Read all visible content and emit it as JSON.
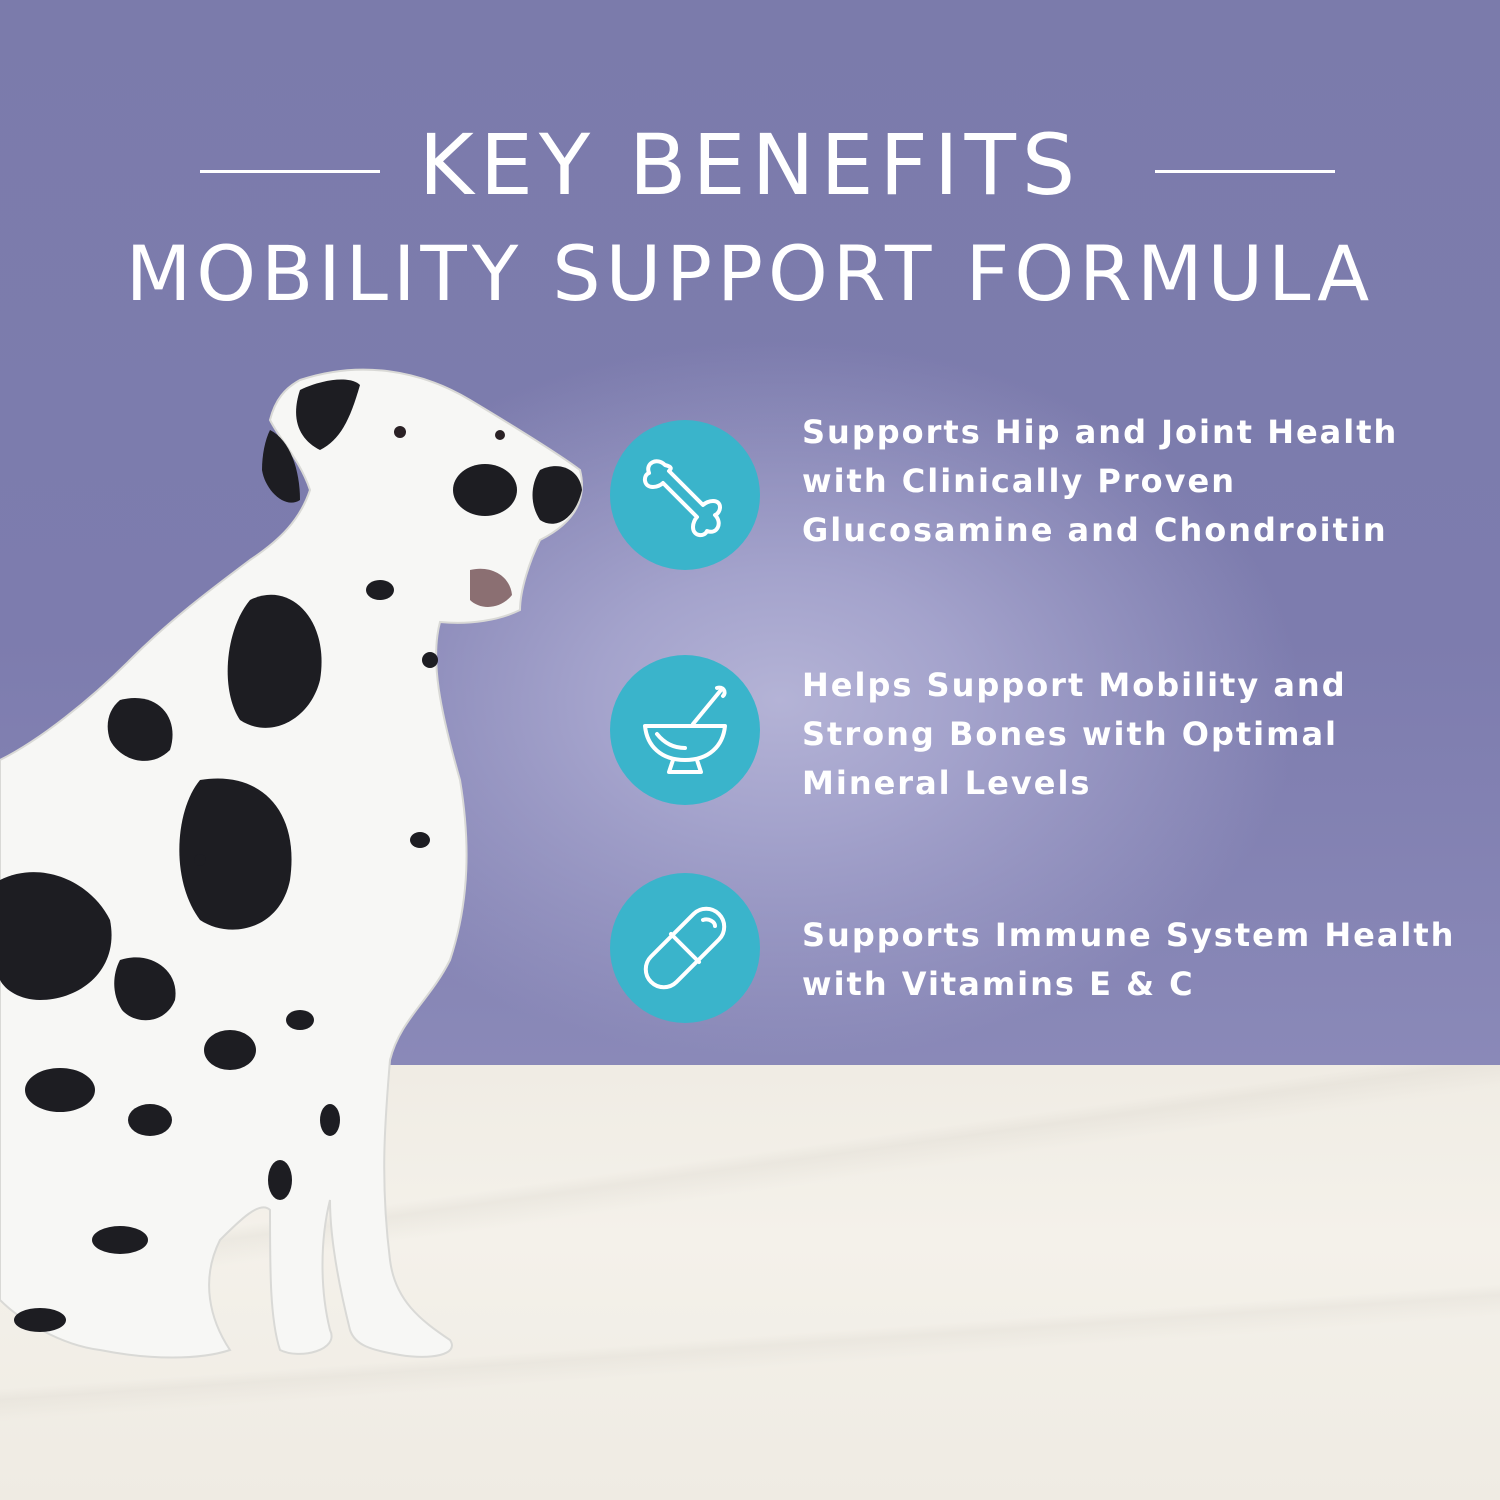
{
  "header": {
    "title": "KEY BENEFITS",
    "subtitle": "MOBILITY SUPPORT FORMULA"
  },
  "benefits": [
    {
      "icon": "bone-icon",
      "lines": [
        "Supports Hip and Joint Health",
        "with Clinically Proven",
        "Glucosamine and Chondroitin"
      ]
    },
    {
      "icon": "mortar-pestle-icon",
      "lines": [
        "Helps Support Mobility and",
        "Strong Bones with Optimal",
        "Mineral Levels"
      ]
    },
    {
      "icon": "capsule-icon",
      "lines": [
        "Supports Immune System Health",
        "with Vitamins E & C"
      ]
    }
  ],
  "colors": {
    "background": "#7d7cae",
    "icon_circle": "#3ab4cb",
    "text": "#ffffff",
    "floor": "#f2efe8"
  }
}
